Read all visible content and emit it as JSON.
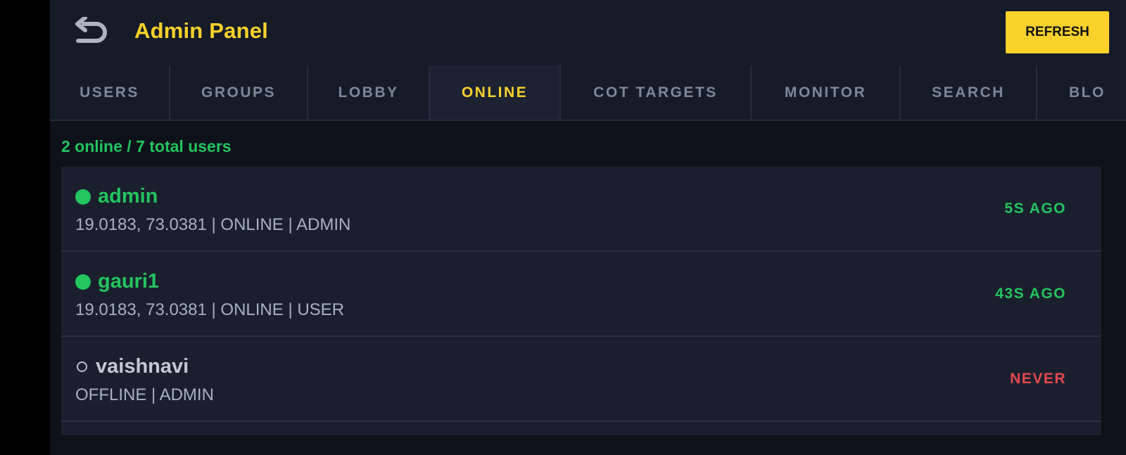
{
  "header": {
    "back_icon": "undo-arrow-icon",
    "title": "Admin Panel",
    "refresh_label": "REFRESH"
  },
  "tabs": [
    {
      "label": "USERS",
      "active": false
    },
    {
      "label": "GROUPS",
      "active": false
    },
    {
      "label": "LOBBY",
      "active": false
    },
    {
      "label": "ONLINE",
      "active": true
    },
    {
      "label": "COT TARGETS",
      "active": false
    },
    {
      "label": "MONITOR",
      "active": false
    },
    {
      "label": "SEARCH",
      "active": false
    },
    {
      "label": "BLO",
      "active": false
    }
  ],
  "summary": "2 online / 7 total users",
  "users": [
    {
      "name": "admin",
      "status": "online",
      "meta": "19.0183, 73.0381 | ONLINE | ADMIN",
      "last_seen": "5S AGO"
    },
    {
      "name": "gauri1",
      "status": "online",
      "meta": "19.0183, 73.0381 | ONLINE | USER",
      "last_seen": "43S AGO"
    },
    {
      "name": "vaishnavi",
      "status": "offline",
      "meta": "OFFLINE | ADMIN",
      "last_seen": "NEVER"
    }
  ],
  "colors": {
    "accent": "#fbd12c",
    "online": "#22c55e",
    "never": "#e5484d",
    "background": "#0d111a",
    "panel": "#161b28",
    "row": "#1a1f2d"
  }
}
